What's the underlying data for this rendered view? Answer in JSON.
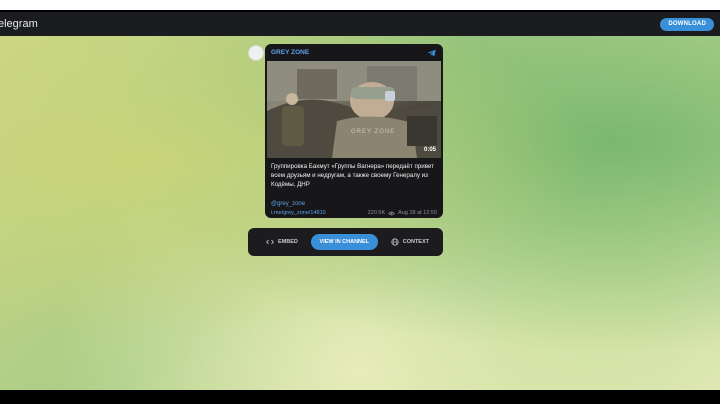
{
  "header": {
    "brand": "elegram",
    "download_label": "DOWNLOAD"
  },
  "post": {
    "channel": "GREY ZONE",
    "video_watermark": "GREY ZONE",
    "duration": "0:05",
    "text": "Группировка Бахмут «Группы Вагнера» передаёт привет всем друзьям и недругам, а также своему Генералу из Кодёмы, ДНР",
    "mention": "@grey_zone",
    "link": "t.me/grey_zone/14810",
    "views": "220.5K",
    "date": "Aug 28 at 12:50"
  },
  "actions": {
    "embed_label": "EMBED",
    "view_label": "VIEW IN CHANNEL",
    "context_label": "CONTEXT"
  },
  "colors": {
    "accent": "#3a8fd9",
    "link": "#5aa3e6",
    "card_bg": "#17171a"
  },
  "icons": [
    "telegram-plane-icon",
    "eye-icon",
    "code-icon",
    "globe-icon"
  ]
}
